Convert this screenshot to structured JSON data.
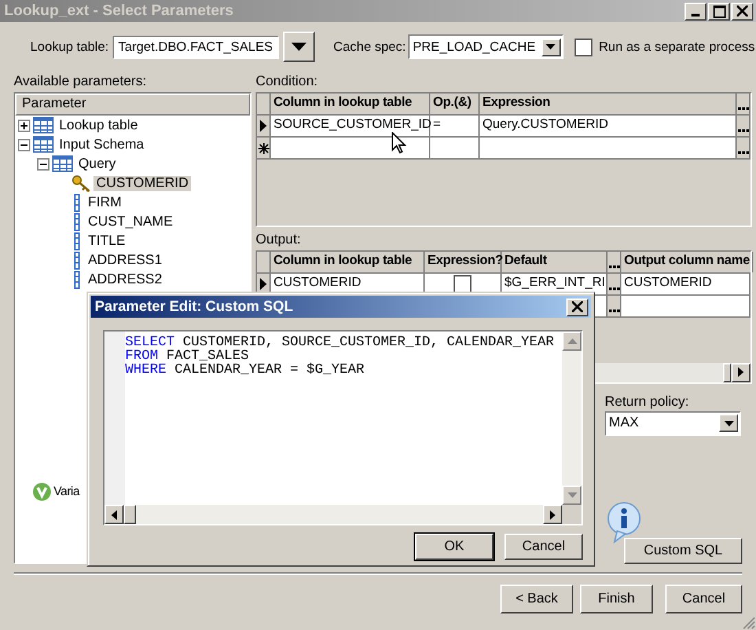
{
  "window": {
    "title": "Lookup_ext - Select Parameters"
  },
  "lookup_table": {
    "label": "Lookup table:",
    "value": "Target.DBO.FACT_SALES"
  },
  "cache_spec": {
    "label": "Cache spec:",
    "value": "PRE_LOAD_CACHE"
  },
  "run_separate": {
    "label": "Run as a separate process",
    "checked": false
  },
  "parameters": {
    "label": "Available parameters:",
    "header": "Parameter",
    "tree": [
      {
        "label": "Lookup table",
        "kind": "table",
        "expanded": false,
        "selected": false
      },
      {
        "label": "Input Schema",
        "kind": "table",
        "expanded": true,
        "selected": false,
        "children": [
          {
            "label": "Query",
            "kind": "table",
            "expanded": true,
            "selected": false,
            "children": [
              {
                "label": "CUSTOMERID",
                "kind": "key",
                "selected": true
              },
              {
                "label": "FIRM",
                "kind": "column",
                "selected": false
              },
              {
                "label": "CUST_NAME",
                "kind": "column",
                "selected": false
              },
              {
                "label": "TITLE",
                "kind": "column",
                "selected": false
              },
              {
                "label": "ADDRESS1",
                "kind": "column",
                "selected": false
              },
              {
                "label": "ADDRESS2",
                "kind": "column",
                "selected": false
              }
            ]
          }
        ]
      },
      {
        "label": "Varia",
        "kind": "variable",
        "selected": false
      }
    ]
  },
  "condition": {
    "label": "Condition:",
    "columns": [
      "Column in lookup table",
      "Op.(&)",
      "Expression"
    ],
    "rows": [
      {
        "current": true,
        "cells": [
          "SOURCE_CUSTOMER_ID",
          "=",
          "Query.CUSTOMERID"
        ]
      }
    ]
  },
  "output": {
    "label": "Output:",
    "columns": [
      "Column in lookup table",
      "Expression?",
      "Default",
      "Output column name"
    ],
    "rows": [
      {
        "current": true,
        "column": "CUSTOMERID",
        "expression": false,
        "default": "$G_ERR_INT_RI",
        "output": "CUSTOMERID"
      }
    ]
  },
  "return_policy": {
    "label": "Return policy:",
    "value": "MAX"
  },
  "custom_sql_button": "Custom SQL",
  "buttons": [
    "< Back",
    "Finish",
    "Cancel"
  ],
  "dialog": {
    "title": "Parameter Edit: Custom SQL",
    "lines": [
      {
        "keyword": "SELECT",
        "rest": " CUSTOMERID, SOURCE_CUSTOMER_ID, CALENDAR_YEAR"
      },
      {
        "keyword": "FROM",
        "rest": " FACT_SALES"
      },
      {
        "keyword": "WHERE",
        "rest": " CALENDAR_YEAR = $G_YEAR"
      }
    ],
    "buttons": [
      "OK",
      "Cancel"
    ]
  }
}
